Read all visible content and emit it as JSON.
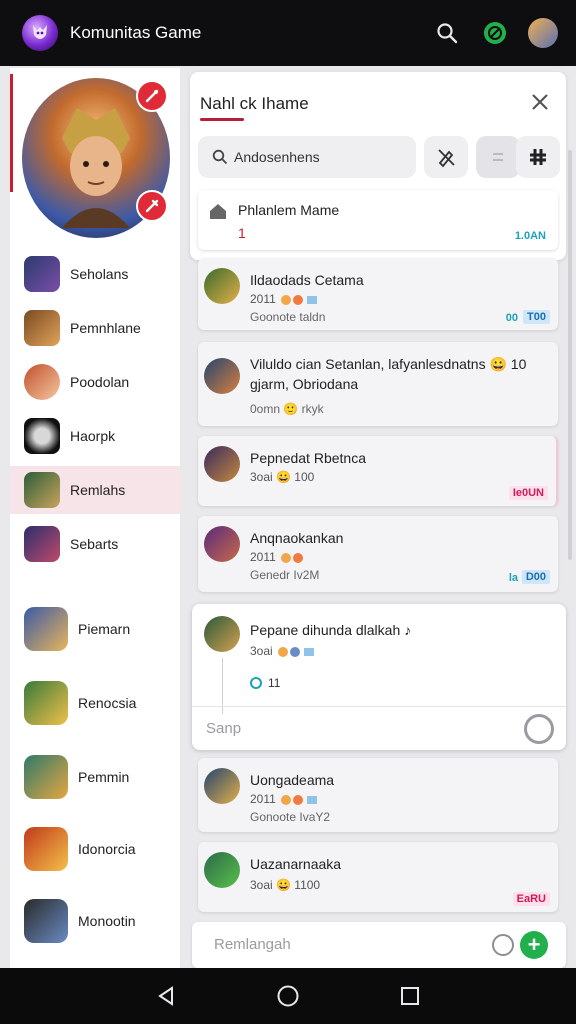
{
  "app": {
    "title": "Komunitas Game",
    "logo_icon": "demon-mascot-logo",
    "accent_red": "#c5202c",
    "accent_green": "#21b04b"
  },
  "topbar": {
    "icons": [
      "search-icon",
      "chat-bubble-icon",
      "user-avatar"
    ]
  },
  "sidebar": {
    "items": [
      {
        "label": "Seholans",
        "colors": [
          "#2c3a6e",
          "#7a4fa8"
        ]
      },
      {
        "label": "Pemnhlane",
        "colors": [
          "#7a4a22",
          "#e0a35a"
        ]
      },
      {
        "label": "Poodolan",
        "colors": [
          "#c2502e",
          "#f4c7a0"
        ]
      },
      {
        "label": "Haorpk",
        "colors": [
          "#111111",
          "#d8d8d8"
        ]
      },
      {
        "label": "Remlahs",
        "colors": [
          "#2b5e3a",
          "#c9a35a"
        ],
        "active": true
      },
      {
        "label": "Sebarts",
        "colors": [
          "#2a2f6e",
          "#c04a6a"
        ]
      },
      {
        "label": "Piemarn",
        "colors": [
          "#3b5aa6",
          "#e8b55a"
        ]
      },
      {
        "label": "Renocsia",
        "colors": [
          "#3a7a3a",
          "#f0c04a"
        ]
      },
      {
        "label": "Pemmin",
        "colors": [
          "#2e7a6a",
          "#e6a640"
        ]
      },
      {
        "label": "Idonorcia",
        "colors": [
          "#c03a1a",
          "#f3c04a"
        ]
      },
      {
        "label": "Monootin",
        "colors": [
          "#2a2a2a",
          "#6a8bc4"
        ]
      }
    ]
  },
  "dialog": {
    "title": "Nahl ck Ihame",
    "search_text": "Andosenhens",
    "tool_icons": [
      "pencil-slash-icon",
      "swap-icon",
      "grid-icon"
    ]
  },
  "pinned": {
    "title": "Phlanlem Mame",
    "number": "1",
    "tag": "1.0AN"
  },
  "cards": [
    {
      "title": "Ildaodads Cetama",
      "meta": "2011",
      "sub": "Goonote taldn",
      "prefix": "00",
      "tag": "T00",
      "tag_style": "blue",
      "avatar": [
        "#3a6b2a",
        "#e4b04a"
      ]
    },
    {
      "title": "Viluldo cian Setanlan, lafyanlesdnatns 😀 10 gjarm, Obriodana",
      "meta": "",
      "sub": "0omn 🙂 rkyk",
      "prefix": "",
      "tag": "",
      "tag_style": "",
      "avatar": [
        "#24456e",
        "#d88040"
      ]
    },
    {
      "title": "Pepnedat Rbetnca",
      "meta": "3oai 😀 100",
      "sub": "",
      "prefix": "",
      "tag": "Ie0UN",
      "tag_style": "pink",
      "avatar": [
        "#3a2a5e",
        "#c58840"
      ]
    },
    {
      "title": "Anqnaokankan",
      "meta": "2011",
      "sub": "Genedr Iv2M",
      "prefix": "la",
      "tag": "D00",
      "tag_style": "blue",
      "avatar": [
        "#5a2a7a",
        "#c86a4a"
      ]
    }
  ],
  "expanded": {
    "title": "Pepane dihunda dlalkah ♪",
    "meta": "3oai",
    "reaction": "11",
    "reply_placeholder": "Sanp"
  },
  "cards_bottom": [
    {
      "title": "Uongadeama",
      "meta": "2011",
      "sub": "Gonoote IvaY2",
      "prefix": "",
      "tag": "",
      "tag_style": "",
      "avatar": [
        "#24456e",
        "#e4b04a"
      ]
    },
    {
      "title": "Uazanarnaaka",
      "meta": "3oai 😀 1100",
      "sub": "",
      "prefix": "",
      "tag": "EaRU",
      "tag_style": "pink",
      "avatar": [
        "#2b6a4a",
        "#5ac04a"
      ]
    }
  ],
  "compose": {
    "placeholder": "Remlangah"
  }
}
